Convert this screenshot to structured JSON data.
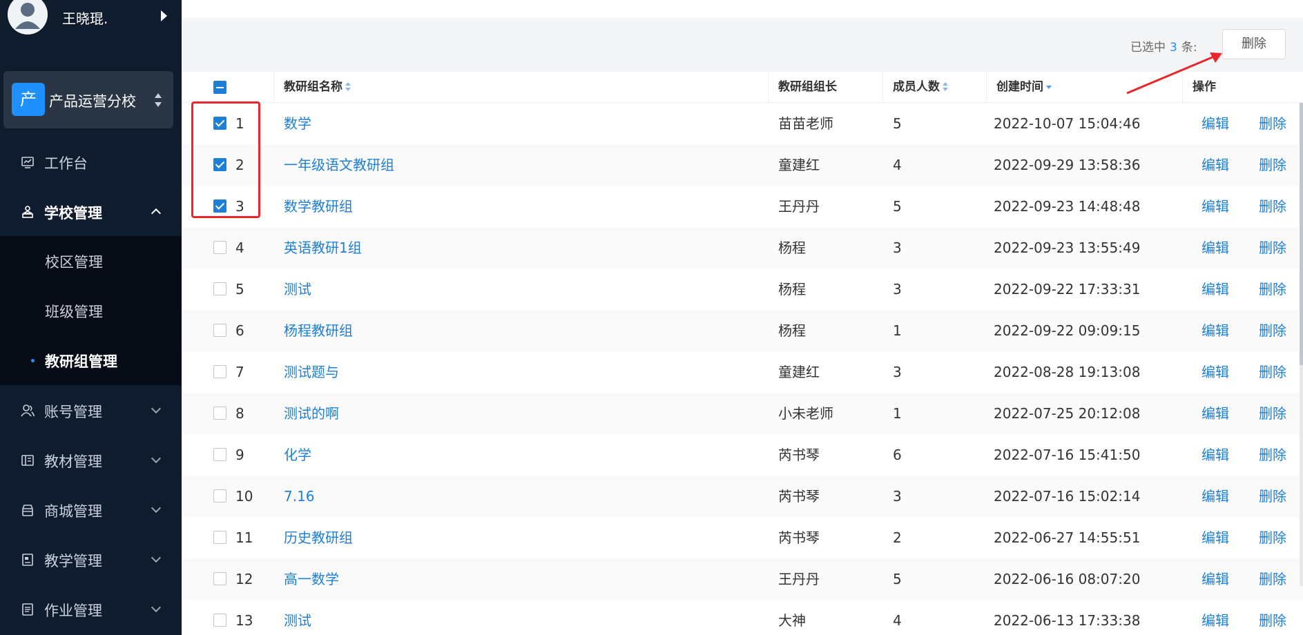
{
  "user": {
    "name": "王晓琨."
  },
  "school": {
    "logo_char": "产",
    "name": "产品运营分校"
  },
  "menu": {
    "workbench": "工作台",
    "school_mgmt": "学校管理",
    "sub": {
      "campus": "校区管理",
      "class": "班级管理",
      "research": "教研组管理"
    },
    "account": "账号管理",
    "textbook": "教材管理",
    "mall": "商城管理",
    "teaching": "教学管理",
    "homework": "作业管理"
  },
  "toolbar": {
    "selected_prefix": "已选中",
    "selected_count": "3",
    "selected_suffix": "条:",
    "delete_label": "删除"
  },
  "table": {
    "headers": {
      "name": "教研组名称",
      "leader": "教研组组长",
      "members": "成员人数",
      "created": "创建时间",
      "ops": "操作"
    },
    "action_edit": "编辑",
    "action_delete": "删除",
    "rows": [
      {
        "idx": "1",
        "name": "数学",
        "leader": "苗苗老师",
        "members": "5",
        "created": "2022-10-07 15:04:46",
        "checked": true
      },
      {
        "idx": "2",
        "name": "一年级语文教研组",
        "leader": "童建红",
        "members": "4",
        "created": "2022-09-29 13:58:36",
        "checked": true
      },
      {
        "idx": "3",
        "name": "数学教研组",
        "leader": "王丹丹",
        "members": "5",
        "created": "2022-09-23 14:48:48",
        "checked": true
      },
      {
        "idx": "4",
        "name": "英语教研1组",
        "leader": "杨程",
        "members": "3",
        "created": "2022-09-23 13:55:49",
        "checked": false
      },
      {
        "idx": "5",
        "name": "测试",
        "leader": "杨程",
        "members": "3",
        "created": "2022-09-22 17:33:31",
        "checked": false
      },
      {
        "idx": "6",
        "name": "杨程教研组",
        "leader": "杨程",
        "members": "1",
        "created": "2022-09-22 09:09:15",
        "checked": false
      },
      {
        "idx": "7",
        "name": "测试题与",
        "leader": "童建红",
        "members": "3",
        "created": "2022-08-28 19:13:08",
        "checked": false
      },
      {
        "idx": "8",
        "name": "测试的啊",
        "leader": "小未老师",
        "members": "1",
        "created": "2022-07-25 20:12:08",
        "checked": false
      },
      {
        "idx": "9",
        "name": "化学",
        "leader": "芮书琴",
        "members": "6",
        "created": "2022-07-16 15:41:50",
        "checked": false
      },
      {
        "idx": "10",
        "name": "7.16",
        "leader": "芮书琴",
        "members": "3",
        "created": "2022-07-16 15:02:14",
        "checked": false
      },
      {
        "idx": "11",
        "name": "历史教研组",
        "leader": "芮书琴",
        "members": "2",
        "created": "2022-06-27 14:55:51",
        "checked": false
      },
      {
        "idx": "12",
        "name": "高一数学",
        "leader": "王丹丹",
        "members": "5",
        "created": "2022-06-16 08:07:20",
        "checked": false
      },
      {
        "idx": "13",
        "name": "测试",
        "leader": "大神",
        "members": "4",
        "created": "2022-06-13 17:33:38",
        "checked": false
      }
    ]
  },
  "colors": {
    "sidebar_bg": "#0f1c2e",
    "accent": "#1e7fd6",
    "annotation_red": "#e8262b"
  },
  "icons": [
    "user-avatar-icon",
    "caret-right-icon",
    "sort-icon",
    "chart-icon",
    "school-icon",
    "users-icon",
    "book-icon",
    "store-icon",
    "document-icon",
    "clipboard-icon",
    "chevron-down-icon",
    "chevron-up-icon"
  ]
}
